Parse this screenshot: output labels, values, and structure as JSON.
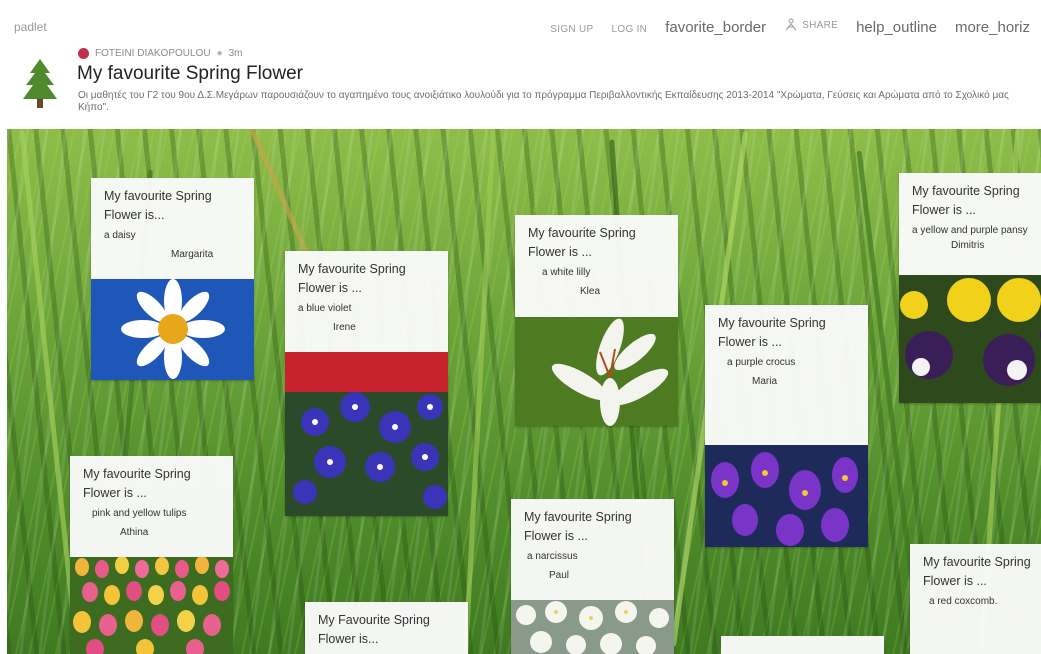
{
  "header": {
    "brand": "padlet",
    "nav": {
      "sign_up": "SIGN UP",
      "log_in": "LOG IN",
      "favorite": "favorite_border",
      "share": "SHARE",
      "help": "help_outline",
      "more": "more_horiz"
    },
    "author": "FOTEINI DIAKOPOULOU",
    "time": "3m",
    "title": "My favourite Spring Flower",
    "description": "Οι μαθητές του Γ2 του 9ου Δ.Σ.Μεγάρων παρουσιάζουν το αγαπημένο τους ανοιξιάτικο λουλούδι για το πρόγραμμα Περιβαλλοντικής Εκπαίδευσης 2013-2014 \"Χρώματα, Γεύσεις και Αρώματα από το Σχολικό μας Κήπο\"."
  },
  "posts": [
    {
      "title": "My favourite Spring Flower is...",
      "body": "a daisy",
      "author": "Margarita",
      "image": "daisy"
    },
    {
      "title": "My favourite Spring Flower is ...",
      "body": "a blue violet",
      "author": "Irene",
      "image": "blue violets"
    },
    {
      "title": "My favourite Spring Flower is ...",
      "body": "a white lilly",
      "author": "Klea",
      "image": "white lily"
    },
    {
      "title": "My favourite Spring Flower is ...",
      "body": "a purple crocus",
      "author": "Maria",
      "image": "purple crocuses"
    },
    {
      "title": "My favourite Spring Flower is ...",
      "body": "a yellow and purple pansy",
      "author": "Dimitris",
      "image": "pansies"
    },
    {
      "title": "My favourite Spring Flower is ...",
      "body": "pink and yellow tulips",
      "author": "Athina",
      "image": "tulips"
    },
    {
      "title": "My favourite Spring Flower is ...",
      "body": "a  narcissus",
      "author": "Paul",
      "image": "narcissus"
    },
    {
      "title": "My Favourite Spring Flower is...",
      "body": "",
      "author": "",
      "image": ""
    },
    {
      "title": "My favourite Spring Flower is ...",
      "body": "a red  coxcomb.",
      "author": "",
      "image": ""
    }
  ],
  "colors": {
    "accent_avatar": "#c0304a",
    "wall_grass": "#5e9a32",
    "tree": "#4f8a2f"
  }
}
